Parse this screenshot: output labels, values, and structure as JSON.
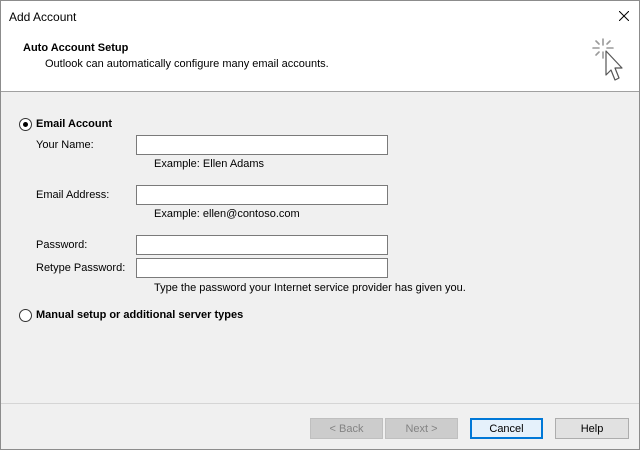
{
  "window": {
    "title": "Add Account"
  },
  "header": {
    "title": "Auto Account Setup",
    "subtitle": "Outlook can automatically configure many email accounts."
  },
  "email_account": {
    "label": "Email Account",
    "selected": true,
    "your_name_label": "Your Name:",
    "your_name_value": "",
    "your_name_example": "Example: Ellen Adams",
    "email_label": "Email Address:",
    "email_value": "",
    "email_example": "Example: ellen@contoso.com",
    "password_label": "Password:",
    "password_value": "",
    "retype_label": "Retype Password:",
    "retype_value": "",
    "password_hint": "Type the password your Internet service provider has given you."
  },
  "manual_setup": {
    "label": "Manual setup or additional server types",
    "selected": false
  },
  "buttons": {
    "back": "< Back",
    "next": "Next >",
    "cancel": "Cancel",
    "help": "Help"
  },
  "icons": {
    "close": "close-icon",
    "wizard": "magic-wand-cursor-icon"
  }
}
